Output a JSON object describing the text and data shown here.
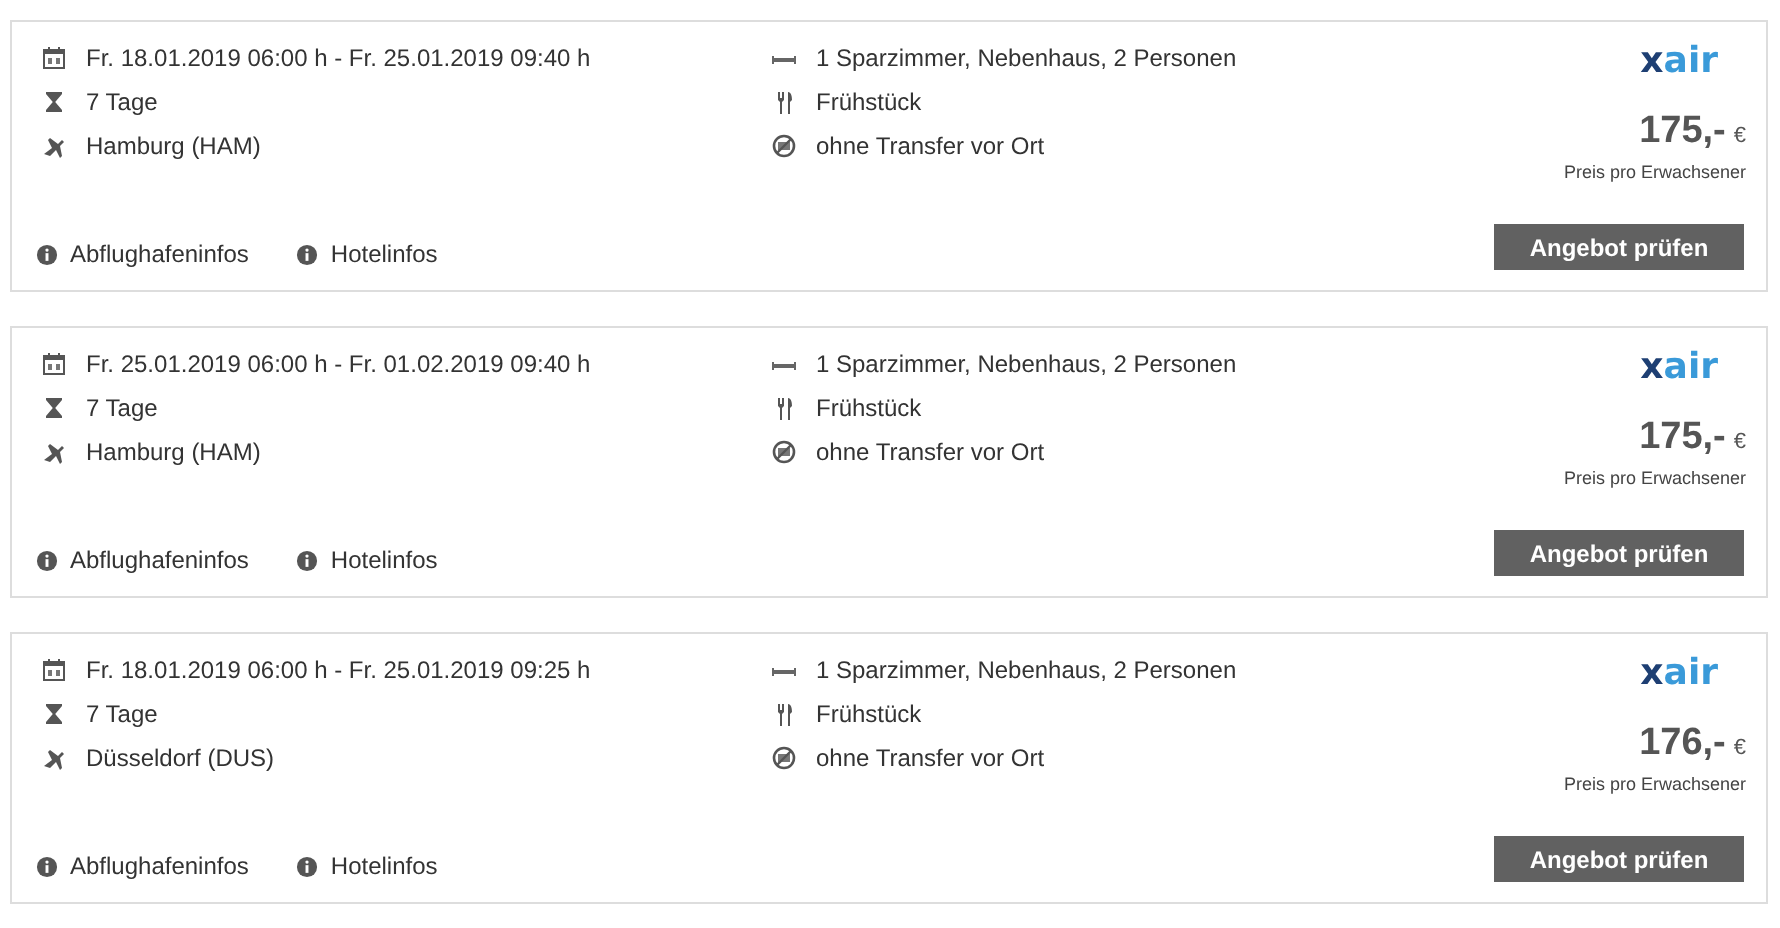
{
  "offers": [
    {
      "dates": "Fr. 18.01.2019 06:00 h - Fr. 25.01.2019 09:40 h",
      "duration": "7 Tage",
      "airport": "Hamburg (HAM)",
      "room": "1 Sparzimmer, Nebenhaus, 2 Personen",
      "board": "Frühstück",
      "transfer": "ohne Transfer vor Ort",
      "logo": {
        "mark": "x",
        "word": "air"
      },
      "price": "175,-",
      "currency": "€",
      "price_note": "Preis pro Erwachsener",
      "button": "Angebot prüfen",
      "links": [
        "Abflughafeninfos",
        "Hotelinfos"
      ]
    },
    {
      "dates": "Fr. 25.01.2019 06:00 h - Fr. 01.02.2019 09:40 h",
      "duration": "7 Tage",
      "airport": "Hamburg (HAM)",
      "room": "1 Sparzimmer, Nebenhaus, 2 Personen",
      "board": "Frühstück",
      "transfer": "ohne Transfer vor Ort",
      "logo": {
        "mark": "x",
        "word": "air"
      },
      "price": "175,-",
      "currency": "€",
      "price_note": "Preis pro Erwachsener",
      "button": "Angebot prüfen",
      "links": [
        "Abflughafeninfos",
        "Hotelinfos"
      ]
    },
    {
      "dates": "Fr. 18.01.2019 06:00 h - Fr. 25.01.2019 09:25 h",
      "duration": "7 Tage",
      "airport": "Düsseldorf (DUS)",
      "room": "1 Sparzimmer, Nebenhaus, 2 Personen",
      "board": "Frühstück",
      "transfer": "ohne Transfer vor Ort",
      "logo": {
        "mark": "x",
        "word": "air"
      },
      "price": "176,-",
      "currency": "€",
      "price_note": "Preis pro Erwachsener",
      "button": "Angebot prüfen",
      "links": [
        "Abflughafeninfos",
        "Hotelinfos"
      ]
    }
  ]
}
